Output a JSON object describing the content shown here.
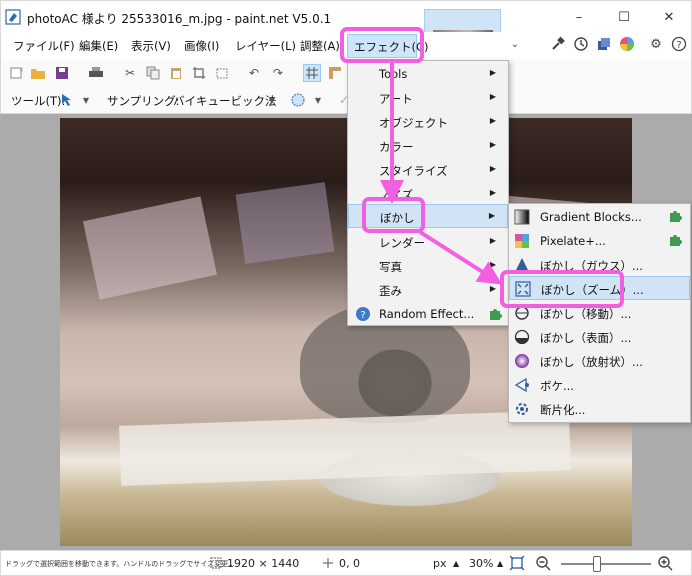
{
  "window": {
    "title": "photoAC 様より 25533016_m.jpg - paint.net V5.0.1",
    "minimize_glyph": "–",
    "maximize_glyph": "☐",
    "close_glyph": "✕"
  },
  "menubar": {
    "items": [
      "ファイル(F)",
      "編集(E)",
      "表示(V)",
      "画像(I)",
      "レイヤー(L)",
      "調整(A)",
      "エフェクト(C)"
    ],
    "active_index": 6
  },
  "toolbar2": {
    "tool_label": "ツール(T):",
    "sampling_label": "サンプリング:",
    "sampling_value": "バイキュービック法"
  },
  "effects_menu": {
    "items": [
      {
        "label": "Tools",
        "submenu": true
      },
      {
        "label": "アート",
        "submenu": true
      },
      {
        "label": "オブジェクト",
        "submenu": true
      },
      {
        "label": "カラー",
        "submenu": true
      },
      {
        "label": "スタイライズ",
        "submenu": true
      },
      {
        "label": "ノイズ",
        "submenu": true
      },
      {
        "label": "ぼかし",
        "submenu": true,
        "selected": true
      },
      {
        "label": "レンダー",
        "submenu": true
      },
      {
        "label": "写真",
        "submenu": true
      },
      {
        "label": "歪み",
        "submenu": true
      },
      {
        "label": "Random Effect...",
        "submenu": false
      }
    ]
  },
  "blur_menu": {
    "items": [
      {
        "label": "Gradient Blocks...",
        "icon": "gradient-blocks-icon",
        "plugin": true
      },
      {
        "label": "Pixelate+...",
        "icon": "pixelate-icon",
        "plugin": true
      },
      {
        "label": "ぼかし（ガウス）...",
        "icon": "gaussian-blur-icon"
      },
      {
        "label": "ぼかし（ズーム）...",
        "icon": "zoom-blur-icon",
        "selected": true
      },
      {
        "label": "ぼかし（移動）...",
        "icon": "motion-blur-icon"
      },
      {
        "label": "ぼかし（表面）...",
        "icon": "surface-blur-icon"
      },
      {
        "label": "ぼかし（放射状）...",
        "icon": "radial-blur-icon"
      },
      {
        "label": "ボケ...",
        "icon": "bokeh-icon"
      },
      {
        "label": "断片化...",
        "icon": "fragment-icon"
      }
    ]
  },
  "statusbar": {
    "hint": "ドラッグで選択範囲を移動できます。ハンドルのドラッグでサイズ変更...",
    "image_size": "1920 × 1440",
    "cursor_pos": "0, 0",
    "unit": "px",
    "zoom": "30%"
  },
  "colors": {
    "highlight": "#f25fe0",
    "selection_bg": "#d1e4f6",
    "plugin_green": "#3f9b4f"
  }
}
